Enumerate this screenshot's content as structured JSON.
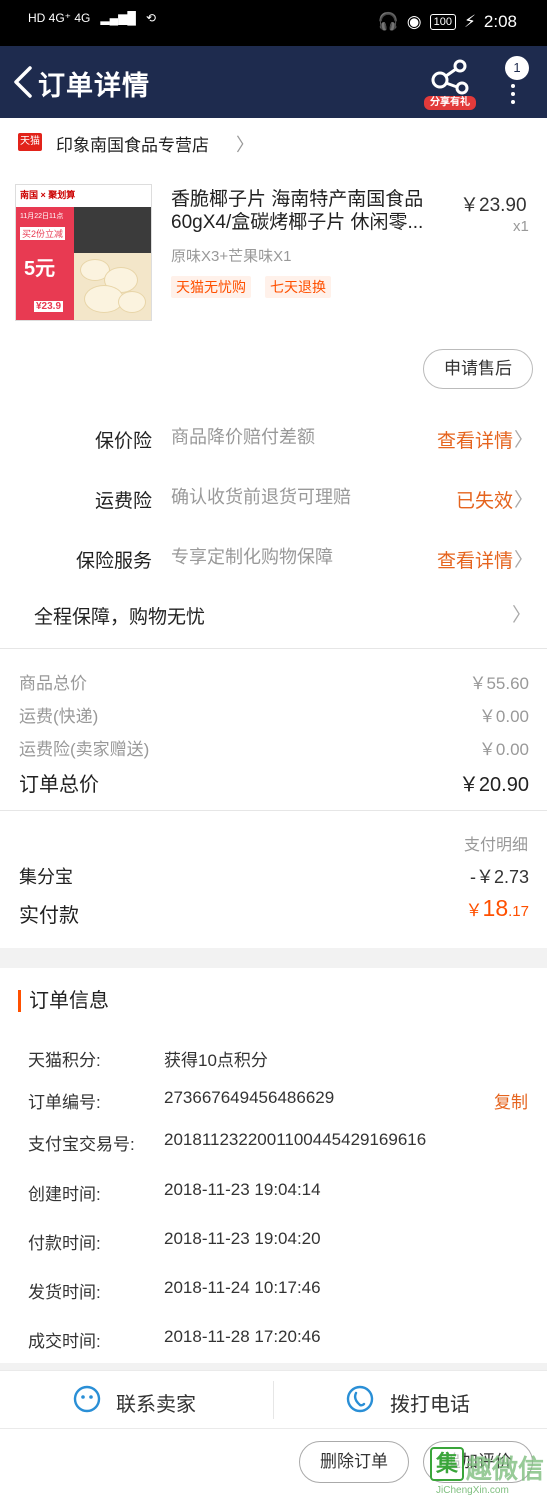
{
  "status_bar": {
    "signal_left": "HD 4G⁺ 4G",
    "battery": "100",
    "time": "2:08"
  },
  "navbar": {
    "title": "订单详情",
    "share_label": "分享有礼",
    "message_count": "1"
  },
  "store": {
    "badge": "天猫",
    "name": "印象南国食品专营店"
  },
  "product": {
    "thumb_brand": "南国 × 聚划算",
    "thumb_promo_line1": "11月22日11点",
    "thumb_promo_line2": "买2份立减",
    "thumb_promo_big": "5元",
    "thumb_price": "¥23.9",
    "title": "香脆椰子片 海南特产南国食品60gX4/盒碳烤椰子片 休闲零...",
    "price": "￥23.90",
    "quantity": "x1",
    "sku": "原味X3+芒果味X1",
    "tags": [
      "天猫无忧购",
      "七天退换"
    ],
    "aftersale_label": "申请售后"
  },
  "insurance": [
    {
      "label": "保价险",
      "desc": "商品降价赔付差额",
      "action": "查看详情"
    },
    {
      "label": "运费险",
      "desc": "确认收货前退货可理赔",
      "action": "已失效"
    },
    {
      "label": "保险服务",
      "desc": "专享定制化购物保障",
      "action": "查看详情"
    }
  ],
  "guarantee": "全程保障，购物无忧",
  "summary": {
    "rows": [
      {
        "label": "商品总价",
        "value": "￥55.60"
      },
      {
        "label": "运费(快递)",
        "value": "￥0.00"
      },
      {
        "label": "运费险(卖家赠送)",
        "value": "￥0.00"
      }
    ],
    "total_label": "订单总价",
    "total_value": "￥20.90"
  },
  "payment": {
    "detail_label": "支付明细",
    "jifenbao_label": "集分宝",
    "jifenbao_value": "-￥2.73",
    "paid_label": "实付款",
    "paid_yen": "￥",
    "paid_int": "18",
    "paid_dec": ".17"
  },
  "order_info": {
    "heading": "订单信息",
    "rows": [
      {
        "key": "天猫积分:",
        "value": "获得10点积分"
      },
      {
        "key": "订单编号:",
        "value": "273667649456486629"
      },
      {
        "key": "支付宝交易号:",
        "value": "2018112322001100445429169616"
      },
      {
        "key": "创建时间:",
        "value": "2018-11-23 19:04:14"
      },
      {
        "key": "付款时间:",
        "value": "2018-11-23 19:04:20"
      },
      {
        "key": "发货时间:",
        "value": "2018-11-24 10:17:46"
      },
      {
        "key": "成交时间:",
        "value": "2018-11-28 17:20:46"
      }
    ],
    "copy_label": "复制"
  },
  "contact": {
    "seller_label": "联系卖家",
    "phone_label": "拨打电话"
  },
  "bottom": {
    "delete_label": "删除订单",
    "review_label": "追加评价"
  },
  "watermark": {
    "glyph": "集",
    "text": "趣微信",
    "url": "JiChengXin.com"
  },
  "colors": {
    "navbar": "#1e2b4e",
    "accent_orange": "#e5641e",
    "price_orange": "#ff5000",
    "tmall_red": "#e2231a",
    "icon_blue": "#2a8fd6"
  }
}
